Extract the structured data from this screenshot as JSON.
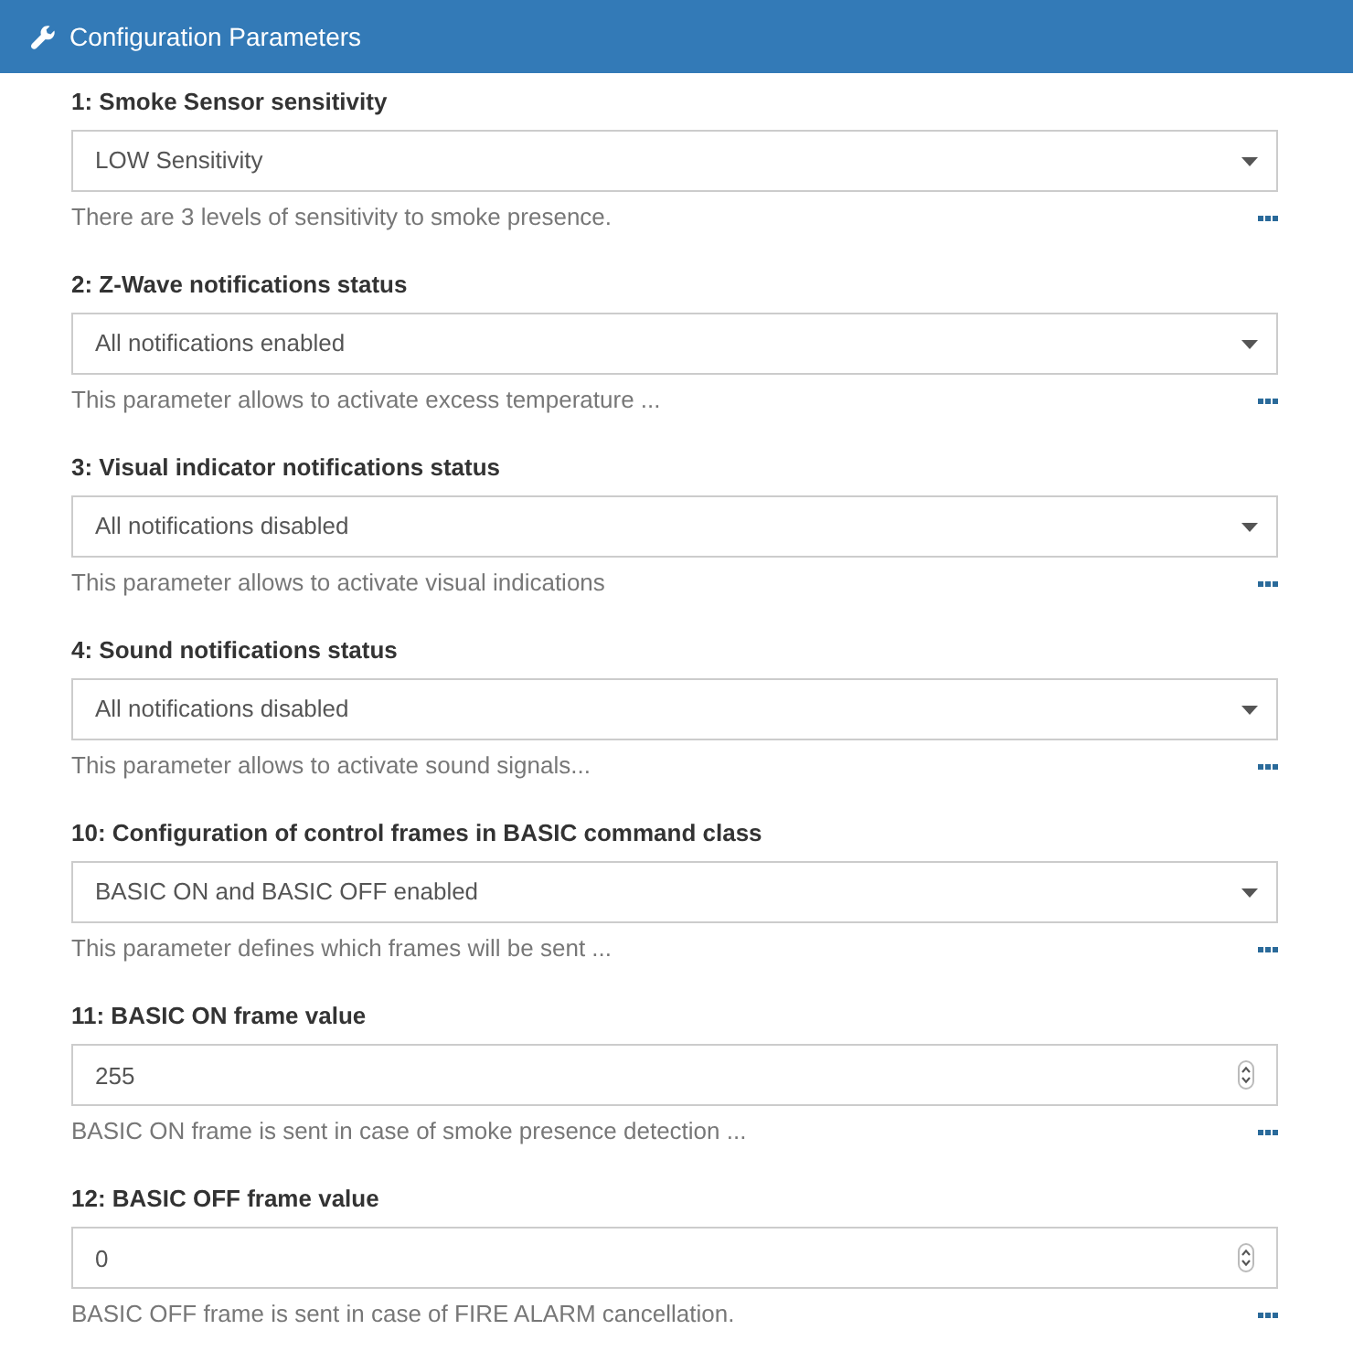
{
  "panel": {
    "title": "Configuration Parameters"
  },
  "parameters": [
    {
      "label": "1: Smoke Sensor sensitivity",
      "kind": "select",
      "value": "LOW Sensitivity",
      "description": "There are 3 levels of sensitivity to smoke presence."
    },
    {
      "label": "2: Z-Wave notifications status",
      "kind": "select",
      "value": "All notifications enabled",
      "description": "This parameter allows to activate excess temperature ..."
    },
    {
      "label": "3: Visual indicator notifications status",
      "kind": "select",
      "value": "All notifications disabled",
      "description": "This parameter allows to activate visual indications"
    },
    {
      "label": "4: Sound notifications status",
      "kind": "select",
      "value": "All notifications disabled",
      "description": "This parameter allows to activate sound signals..."
    },
    {
      "label": "10: Configuration of control frames in BASIC command class",
      "kind": "select",
      "value": "BASIC ON and BASIC OFF enabled",
      "description": "This parameter defines which frames will be sent ..."
    },
    {
      "label": "11: BASIC ON frame value",
      "kind": "number",
      "value": "255",
      "description": "BASIC ON frame is sent in case of smoke presence detection ..."
    },
    {
      "label": "12: BASIC OFF frame value",
      "kind": "number",
      "value": "0",
      "description": "BASIC OFF frame is sent in case of FIRE ALARM cancellation."
    }
  ]
}
